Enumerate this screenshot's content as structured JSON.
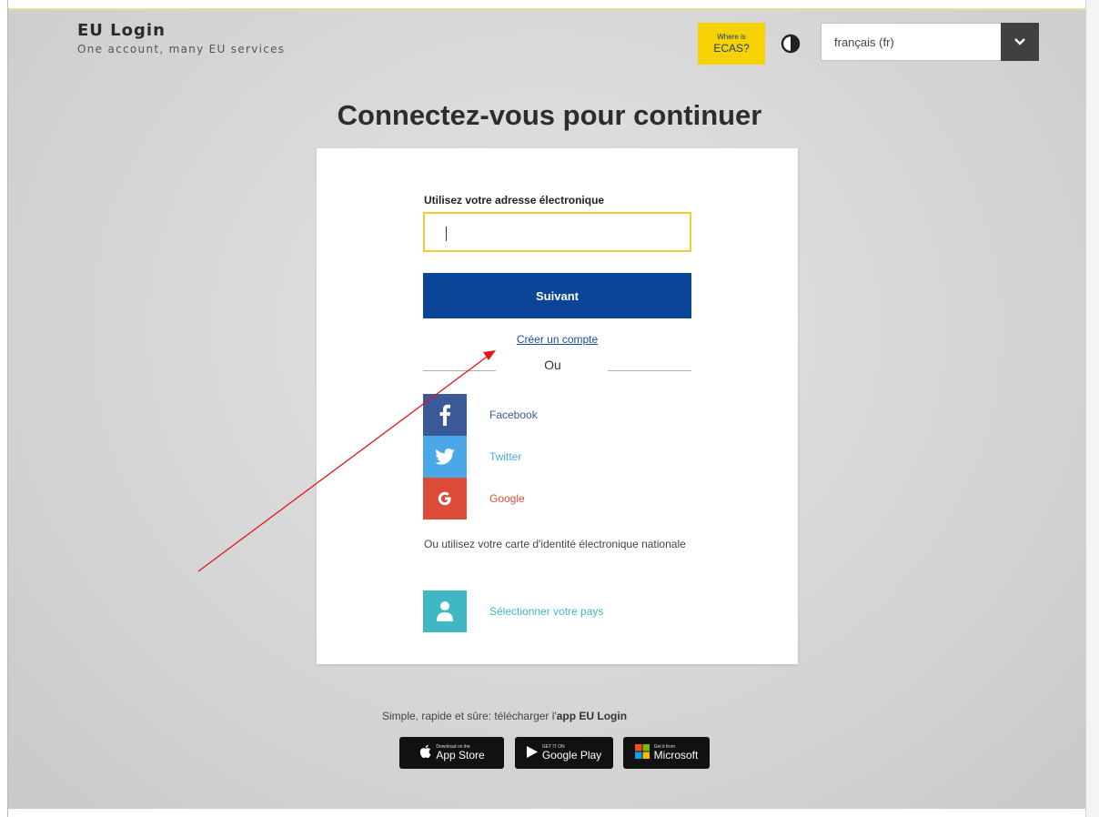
{
  "brand": {
    "title": "EU Login",
    "subtitle": "One account, many EU services"
  },
  "header": {
    "ecas_top": "Where is",
    "ecas_main": "ECAS?",
    "language_selected": "français (fr)"
  },
  "heading": "Connectez-vous pour continuer",
  "form": {
    "email_label": "Utilisez votre adresse électronique",
    "email_value": "",
    "next_button": "Suivant",
    "create_account_link": "Créer un compte",
    "or_text": "Ou"
  },
  "social": [
    {
      "label": "Facebook",
      "icon": "facebook-icon",
      "color": "#3b5999"
    },
    {
      "label": "Twitter",
      "icon": "twitter-icon",
      "color": "#4aa8e8"
    },
    {
      "label": "Google",
      "icon": "google-icon",
      "color": "#dd4b39"
    }
  ],
  "eid": {
    "text": "Ou utilisez votre carte d'identité électronique nationale",
    "link": "Sélectionner votre pays",
    "icon": "user-icon"
  },
  "footer": {
    "text_prefix": "Simple, rapide et sûre: télécharger l'",
    "text_bold": "app EU Login",
    "stores": [
      {
        "small": "Download on the",
        "big": "App Store",
        "icon": "apple-icon"
      },
      {
        "small": "GET IT ON",
        "big": "Google Play",
        "icon": "google-play-icon"
      },
      {
        "small": "Get it from",
        "big": "Microsoft",
        "icon": "microsoft-icon"
      }
    ]
  },
  "colors": {
    "primary": "#0a4597",
    "accent_yellow": "#f5d200",
    "annotation_arrow": "#e0151c"
  }
}
